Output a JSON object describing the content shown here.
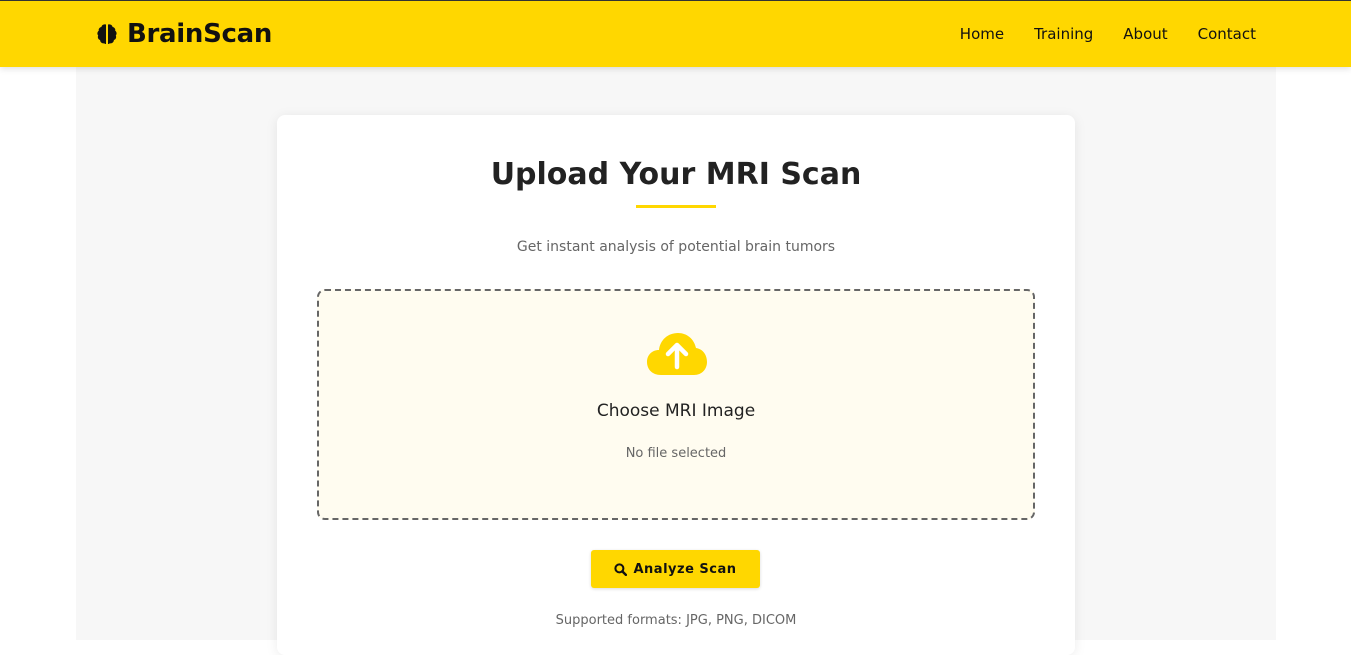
{
  "navbar": {
    "brand": "BrainScan",
    "brand_icon": "brain-icon",
    "links": [
      "Home",
      "Training",
      "About",
      "Contact"
    ]
  },
  "upload_card": {
    "title": "Upload Your MRI Scan",
    "subtitle": "Get instant analysis of potential brain tumors",
    "dropzone": {
      "icon": "cloud-upload-icon",
      "label": "Choose MRI Image",
      "status": "No file selected"
    },
    "analyze_button": {
      "icon": "search-icon",
      "label": "Analyze Scan"
    },
    "formats_note": "Supported formats: JPG, PNG, DICOM"
  },
  "colors": {
    "accent": "#ffd700",
    "text": "#222222",
    "muted": "#666666",
    "dropzone_bg": "#fffcf0",
    "page_bg": "#f7f7f7"
  }
}
